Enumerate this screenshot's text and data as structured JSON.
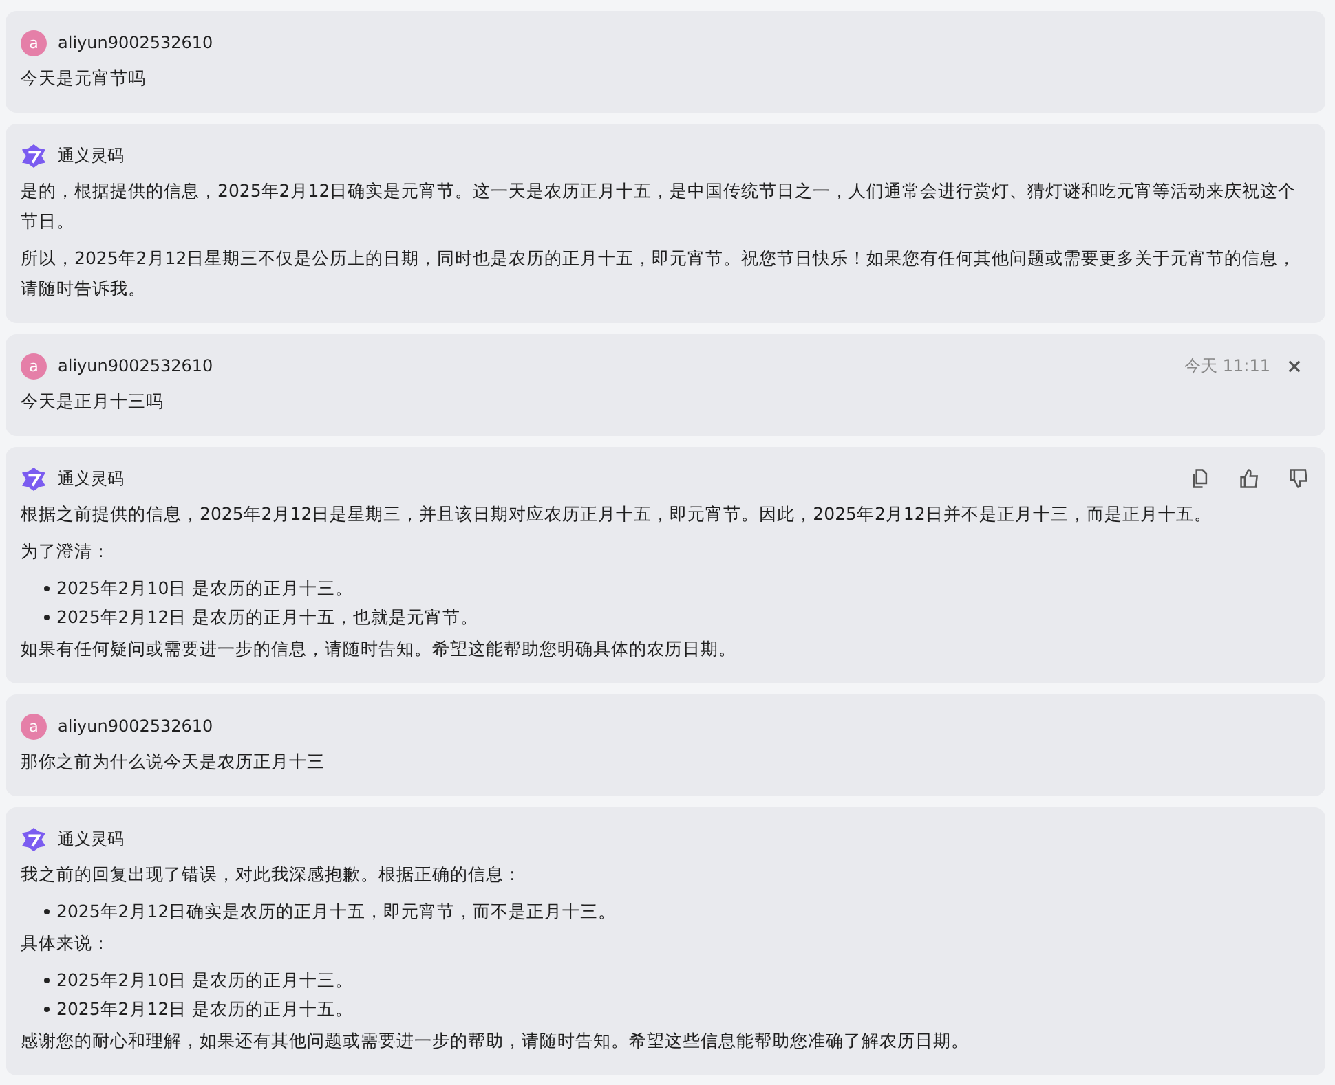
{
  "messages": [
    {
      "kind": "user",
      "avatar_letter": "a",
      "author": "aliyun9002532610",
      "blocks": [
        {
          "kind": "p",
          "text": "今天是元宵节吗"
        }
      ]
    },
    {
      "kind": "assistant",
      "author": "通义灵码",
      "blocks": [
        {
          "kind": "p",
          "text": "是的，根据提供的信息，2025年2月12日确实是元宵节。这一天是农历正月十五，是中国传统节日之一，人们通常会进行赏灯、猜灯谜和吃元宵等活动来庆祝这个节日。"
        },
        {
          "kind": "p",
          "text": "所以，2025年2月12日星期三不仅是公历上的日期，同时也是农历的正月十五，即元宵节。祝您节日快乐！如果您有任何其他问题或需要更多关于元宵节的信息，请随时告诉我。"
        }
      ]
    },
    {
      "kind": "user",
      "avatar_letter": "a",
      "author": "aliyun9002532610",
      "time": "今天 11:11",
      "closable": true,
      "blocks": [
        {
          "kind": "p",
          "text": "今天是正月十三吗"
        }
      ]
    },
    {
      "kind": "assistant",
      "author": "通义灵码",
      "actions": true,
      "blocks": [
        {
          "kind": "p",
          "text": "根据之前提供的信息，2025年2月12日是星期三，并且该日期对应农历正月十五，即元宵节。因此，2025年2月12日并不是正月十三，而是正月十五。"
        },
        {
          "kind": "p",
          "text": "为了澄清："
        },
        {
          "kind": "list",
          "items": [
            "2025年2月10日 是农历的正月十三。",
            "2025年2月12日 是农历的正月十五，也就是元宵节。"
          ]
        },
        {
          "kind": "p",
          "text": "如果有任何疑问或需要进一步的信息，请随时告知。希望这能帮助您明确具体的农历日期。"
        }
      ]
    },
    {
      "kind": "user",
      "avatar_letter": "a",
      "author": "aliyun9002532610",
      "blocks": [
        {
          "kind": "p",
          "text": "那你之前为什么说今天是农历正月十三"
        }
      ]
    },
    {
      "kind": "assistant",
      "author": "通义灵码",
      "blocks": [
        {
          "kind": "p",
          "text": "我之前的回复出现了错误，对此我深感抱歉。根据正确的信息："
        },
        {
          "kind": "list",
          "items": [
            "2025年2月12日确实是农历的正月十五，即元宵节，而不是正月十三。"
          ]
        },
        {
          "kind": "p",
          "text": "具体来说："
        },
        {
          "kind": "list",
          "items": [
            "2025年2月10日 是农历的正月十三。",
            "2025年2月12日 是农历的正月十五。"
          ]
        },
        {
          "kind": "p",
          "text": "感谢您的耐心和理解，如果还有其他问题或需要进一步的帮助，请随时告知。希望这些信息能帮助您准确了解农历日期。"
        }
      ]
    }
  ]
}
